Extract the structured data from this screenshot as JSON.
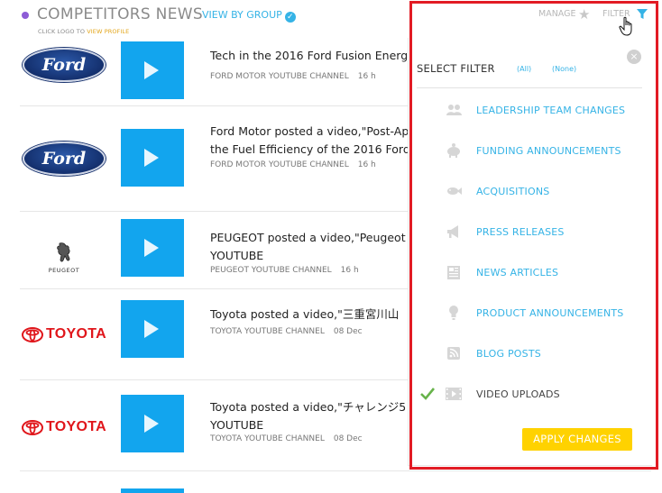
{
  "header": {
    "title": "COMPETITORS NEWS",
    "view_group": "VIEW BY GROUP",
    "subnote_prefix": "CLICK LOGO TO ",
    "subnote_link": "VIEW PROFILE",
    "manage": "MANAGE",
    "filter": "FILTER"
  },
  "feed": [
    {
      "logo": "ford-logo",
      "title_lines": [
        "Tech in the 2016 Ford Fusion Energ"
      ],
      "channel": "FORD MOTOR YOUTUBE CHANNEL",
      "time": "16 h"
    },
    {
      "logo": "ford-logo",
      "title_lines": [
        "Ford Motor posted a video,\"Post-Ap",
        "the Fuel Efficiency of the 2016 Ford"
      ],
      "channel": "FORD MOTOR YOUTUBE CHANNEL",
      "time": "16 h"
    },
    {
      "logo": "peugeot-logo",
      "logo_text": "PEUGEOT",
      "title_lines": [
        "PEUGEOT posted a video,\"Peugeot",
        "YOUTUBE"
      ],
      "channel": "PEUGEOT YOUTUBE CHANNEL",
      "time": "16 h"
    },
    {
      "logo": "toyota-logo",
      "logo_text": "TOYOTA",
      "title_lines": [
        "Toyota posted a video,\"三重宮川山"
      ],
      "channel": "TOYOTA YOUTUBE CHANNEL",
      "time": "08 Dec"
    },
    {
      "logo": "toyota-logo",
      "logo_text": "TOYOTA",
      "title_lines": [
        "Toyota posted a video,\"チャレンジ5",
        "YOUTUBE"
      ],
      "channel": "TOYOTA YOUTUBE CHANNEL",
      "time": "08 Dec"
    }
  ],
  "ford_logo_text": "Ford",
  "filter_panel": {
    "title": "SELECT FILTER",
    "all": "(All)",
    "none": "(None)",
    "close": "×",
    "options": [
      {
        "label": "LEADERSHIP TEAM CHANGES",
        "icon": "people-icon",
        "checked": false
      },
      {
        "label": "FUNDING ANNOUNCEMENTS",
        "icon": "piggy-bank-icon",
        "checked": false
      },
      {
        "label": "ACQUISITIONS",
        "icon": "fish-icon",
        "checked": false
      },
      {
        "label": "PRESS RELEASES",
        "icon": "megaphone-icon",
        "checked": false
      },
      {
        "label": "NEWS ARTICLES",
        "icon": "newspaper-icon",
        "checked": false
      },
      {
        "label": "PRODUCT ANNOUNCEMENTS",
        "icon": "lightbulb-icon",
        "checked": false
      },
      {
        "label": "BLOG POSTS",
        "icon": "rss-icon",
        "checked": false
      },
      {
        "label": "VIDEO UPLOADS",
        "icon": "video-icon",
        "checked": true
      }
    ],
    "apply": "APPLY CHANGES"
  },
  "colors": {
    "accent": "#35b3e6",
    "apply": "#ffd200",
    "highlight": "#e21b24",
    "thumb": "#12a5ee"
  }
}
